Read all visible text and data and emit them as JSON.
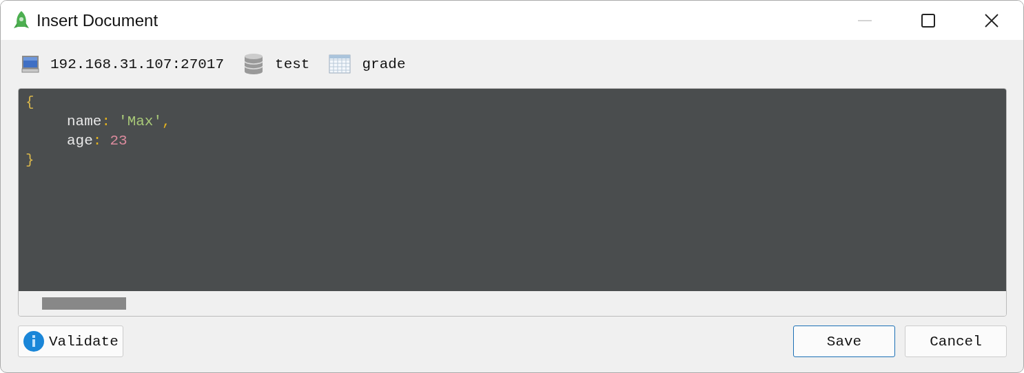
{
  "window": {
    "title": "Insert Document",
    "controls": [
      {
        "kind": "minimize",
        "disabled": true
      },
      {
        "kind": "maximize",
        "disabled": false
      },
      {
        "kind": "close",
        "disabled": false
      }
    ]
  },
  "breadcrumb": [
    {
      "kind": "server",
      "label": "192.168.31.107:27017"
    },
    {
      "kind": "database",
      "label": "test"
    },
    {
      "kind": "collection",
      "label": "grade"
    }
  ],
  "editor": {
    "lines": [
      {
        "indented": false,
        "tokens": [
          {
            "kind": "brace",
            "text": "{"
          }
        ]
      },
      {
        "indented": true,
        "tokens": [
          {
            "kind": "key",
            "text": "name"
          },
          {
            "kind": "punct",
            "text": ":"
          },
          {
            "kind": "string",
            "text": "'Max'"
          },
          {
            "kind": "punct",
            "text": ","
          }
        ]
      },
      {
        "indented": true,
        "tokens": [
          {
            "kind": "key",
            "text": "age"
          },
          {
            "kind": "punct",
            "text": ":"
          },
          {
            "kind": "number",
            "text": "23"
          }
        ]
      },
      {
        "indented": false,
        "tokens": [
          {
            "kind": "brace",
            "text": "}"
          }
        ]
      }
    ]
  },
  "buttons": [
    {
      "kind": "info",
      "label": "Validate",
      "focused": false
    },
    {
      "kind": "plain",
      "label": "Save",
      "focused": true
    },
    {
      "kind": "plain",
      "label": "Cancel",
      "focused": false
    }
  ]
}
